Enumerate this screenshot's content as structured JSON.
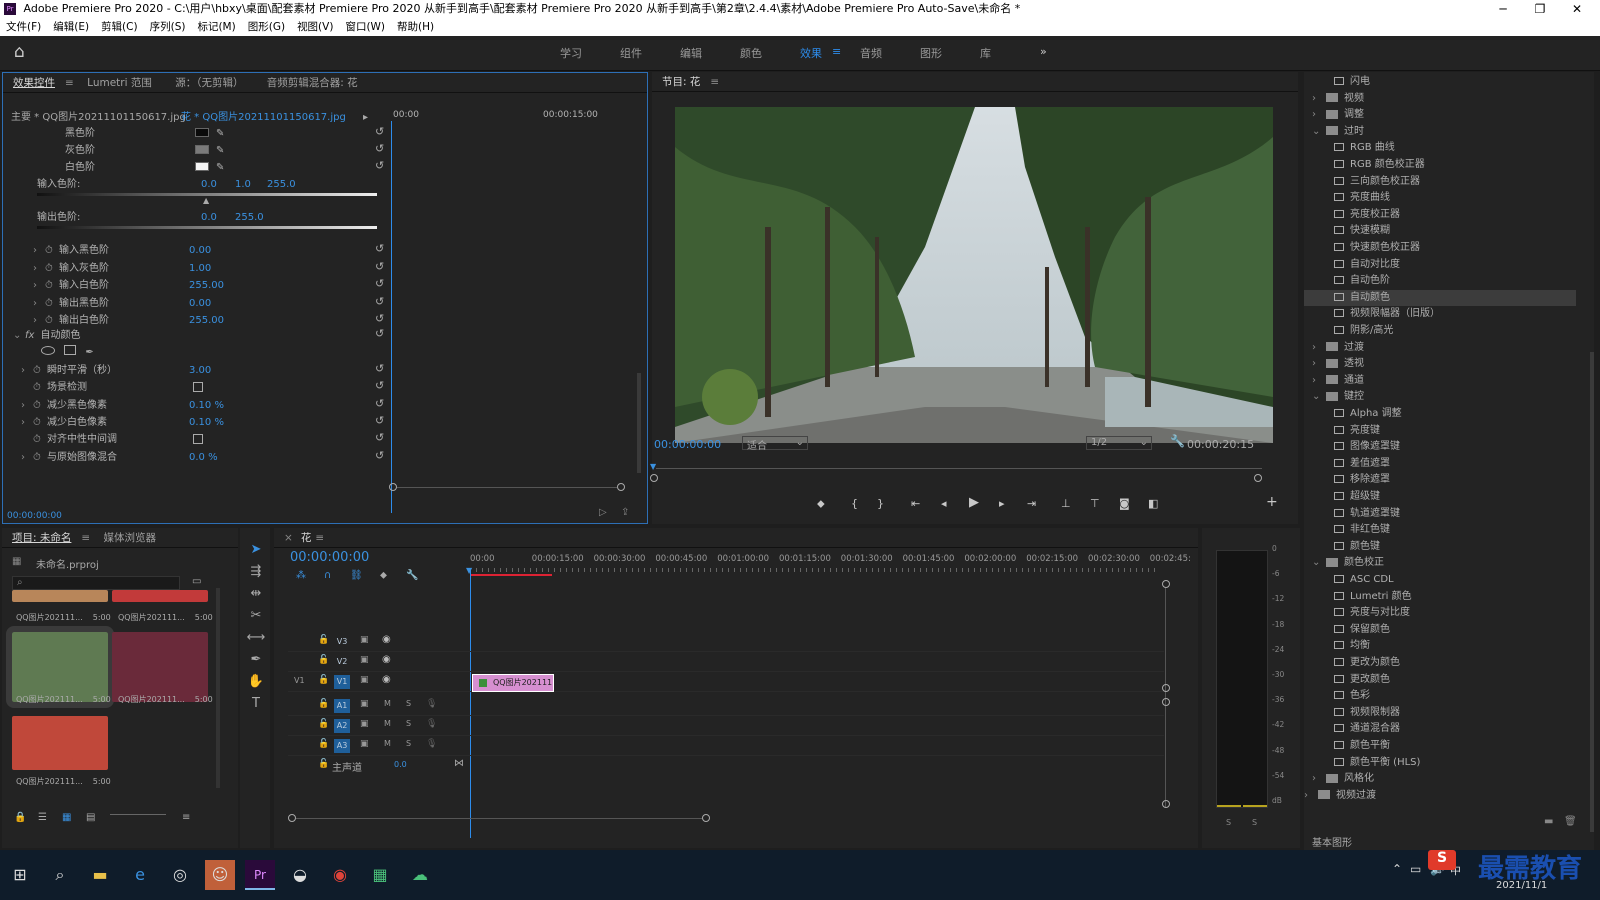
{
  "window": {
    "title": "Adobe Premiere Pro 2020 - C:\\用户\\hbxy\\桌面\\配套素材 Premiere Pro 2020 从新手到高手\\配套素材 Premiere Pro 2020 从新手到高手\\第2章\\2.4.4\\素材\\Adobe Premiere Pro Auto-Save\\未命名 *",
    "icon": "Pr"
  },
  "menu": [
    "文件(F)",
    "编辑(E)",
    "剪辑(C)",
    "序列(S)",
    "标记(M)",
    "图形(G)",
    "视图(V)",
    "窗口(W)",
    "帮助(H)"
  ],
  "workspaces": [
    "学习",
    "组件",
    "编辑",
    "颜色",
    "效果",
    "音频",
    "图形",
    "库"
  ],
  "workspace_active": "效果",
  "effect_controls": {
    "tabs": [
      "效果控件",
      "Lumetri 范围",
      "源：（无剪辑）",
      "音频剪辑混合器: 花"
    ],
    "master": "主要 * QQ图片20211101150617.jpg",
    "clip": "花 * QQ图片20211101150617.jpg",
    "tc_start": "00:00",
    "tc_mid": "00:00:15:00",
    "levels": [
      {
        "label": "黑色阶",
        "swatch": "#0a0a0a"
      },
      {
        "label": "灰色阶",
        "swatch": "#7a7a7a"
      },
      {
        "label": "白色阶",
        "swatch": "#f5f5f5"
      }
    ],
    "input_levels_label": "输入色阶:",
    "input_levels_values": [
      "0.0",
      "1.0",
      "255.0"
    ],
    "output_levels_label": "输出色阶:",
    "output_levels_values": [
      "0.0",
      "255.0"
    ],
    "params": [
      {
        "label": "输入黑色阶",
        "value": "0.00"
      },
      {
        "label": "输入灰色阶",
        "value": "1.00"
      },
      {
        "label": "输入白色阶",
        "value": "255.00"
      },
      {
        "label": "输出黑色阶",
        "value": "0.00"
      },
      {
        "label": "输出白色阶",
        "value": "255.00"
      }
    ],
    "fx_name": "自动颜色",
    "fx_params": [
      {
        "label": "瞬时平滑（秒）",
        "value": "3.00",
        "type": "value"
      },
      {
        "label": "场景检测",
        "value": "",
        "type": "checkbox"
      },
      {
        "label": "减少黑色像素",
        "value": "0.10 %",
        "type": "value"
      },
      {
        "label": "减少白色像素",
        "value": "0.10 %",
        "type": "value"
      },
      {
        "label": "对齐中性中间调",
        "value": "",
        "type": "checkbox"
      },
      {
        "label": "与原始图像混合",
        "value": "0.0 %",
        "type": "value"
      }
    ],
    "timecode": "00:00:00:00"
  },
  "program": {
    "title": "节目: 花",
    "timecode": "00:00:00:00",
    "fit": "适合",
    "resolution": "1/2",
    "duration": "00:00:20:15"
  },
  "effects_tree": [
    {
      "label": "闪电",
      "type": "item",
      "indent": 2
    },
    {
      "label": "视频",
      "type": "folder",
      "indent": 1,
      "open": false
    },
    {
      "label": "调整",
      "type": "folder",
      "indent": 1,
      "open": false
    },
    {
      "label": "过时",
      "type": "folder",
      "indent": 1,
      "open": true
    },
    {
      "label": "RGB 曲线",
      "type": "item",
      "indent": 2
    },
    {
      "label": "RGB 颜色校正器",
      "type": "item",
      "indent": 2
    },
    {
      "label": "三向颜色校正器",
      "type": "item",
      "indent": 2
    },
    {
      "label": "亮度曲线",
      "type": "item",
      "indent": 2
    },
    {
      "label": "亮度校正器",
      "type": "item",
      "indent": 2
    },
    {
      "label": "快速模糊",
      "type": "item",
      "indent": 2
    },
    {
      "label": "快速颜色校正器",
      "type": "item",
      "indent": 2
    },
    {
      "label": "自动对比度",
      "type": "item",
      "indent": 2
    },
    {
      "label": "自动色阶",
      "type": "item",
      "indent": 2
    },
    {
      "label": "自动颜色",
      "type": "item",
      "indent": 2,
      "selected": true
    },
    {
      "label": "视频限幅器（旧版）",
      "type": "item",
      "indent": 2
    },
    {
      "label": "阴影/高光",
      "type": "item",
      "indent": 2
    },
    {
      "label": "过渡",
      "type": "folder",
      "indent": 1,
      "open": false
    },
    {
      "label": "透视",
      "type": "folder",
      "indent": 1,
      "open": false
    },
    {
      "label": "通道",
      "type": "folder",
      "indent": 1,
      "open": false
    },
    {
      "label": "键控",
      "type": "folder",
      "indent": 1,
      "open": true
    },
    {
      "label": "Alpha 调整",
      "type": "item",
      "indent": 2
    },
    {
      "label": "亮度键",
      "type": "item",
      "indent": 2
    },
    {
      "label": "图像遮罩键",
      "type": "item",
      "indent": 2
    },
    {
      "label": "差值遮罩",
      "type": "item",
      "indent": 2
    },
    {
      "label": "移除遮罩",
      "type": "item",
      "indent": 2
    },
    {
      "label": "超级键",
      "type": "item",
      "indent": 2
    },
    {
      "label": "轨道遮罩键",
      "type": "item",
      "indent": 2
    },
    {
      "label": "非红色键",
      "type": "item",
      "indent": 2
    },
    {
      "label": "颜色键",
      "type": "item",
      "indent": 2
    },
    {
      "label": "颜色校正",
      "type": "folder",
      "indent": 1,
      "open": true
    },
    {
      "label": "ASC CDL",
      "type": "item",
      "indent": 2
    },
    {
      "label": "Lumetri 颜色",
      "type": "item",
      "indent": 2
    },
    {
      "label": "亮度与对比度",
      "type": "item",
      "indent": 2
    },
    {
      "label": "保留颜色",
      "type": "item",
      "indent": 2
    },
    {
      "label": "均衡",
      "type": "item",
      "indent": 2
    },
    {
      "label": "更改为颜色",
      "type": "item",
      "indent": 2
    },
    {
      "label": "更改颜色",
      "type": "item",
      "indent": 2
    },
    {
      "label": "色彩",
      "type": "item",
      "indent": 2
    },
    {
      "label": "视频限制器",
      "type": "item",
      "indent": 2
    },
    {
      "label": "通道混合器",
      "type": "item",
      "indent": 2
    },
    {
      "label": "颜色平衡",
      "type": "item",
      "indent": 2
    },
    {
      "label": "颜色平衡 (HLS)",
      "type": "item",
      "indent": 2
    },
    {
      "label": "风格化",
      "type": "folder",
      "indent": 1,
      "open": false
    },
    {
      "label": "视频过渡",
      "type": "folder",
      "indent": 0,
      "open": false
    }
  ],
  "effects_footer": "基本图形",
  "project": {
    "tabs": [
      "项目: 未命名",
      "媒体浏览器"
    ],
    "file": "未命名.prproj",
    "items": [
      {
        "name": "QQ图片202111...",
        "dur": "5:00",
        "color": "#b8865a"
      },
      {
        "name": "QQ图片202111...",
        "dur": "5:00",
        "color": "#c23a3a"
      },
      {
        "name": "QQ图片202111...",
        "dur": "5:00",
        "color": "#5f7a52"
      },
      {
        "name": "QQ图片202111...",
        "dur": "5:00",
        "color": "#6a2a3a"
      },
      {
        "name": "QQ图片202111...",
        "dur": "5:00",
        "color": "#c0483a"
      }
    ]
  },
  "timeline": {
    "tab": "花",
    "timecode": "00:00:00:00",
    "ruler": [
      "00:00",
      "00:00:15:00",
      "00:00:30:00",
      "00:00:45:00",
      "00:01:00:00",
      "00:01:15:00",
      "00:01:30:00",
      "00:01:45:00",
      "00:02:00:00",
      "00:02:15:00",
      "00:02:30:00",
      "00:02:45:"
    ],
    "video_tracks": [
      "V3",
      "V2",
      "V1"
    ],
    "audio_tracks": [
      "A1",
      "A2",
      "A3"
    ],
    "src_v1": "V1",
    "master_label": "主声道",
    "master_value": "0.0",
    "clip_label": "QQ图片202111",
    "mute": "M",
    "solo": "S"
  },
  "meter": {
    "scale": [
      "0",
      "-6",
      "-12",
      "-18",
      "-24",
      "-30",
      "-36",
      "-42",
      "-48",
      "-54",
      "dB"
    ],
    "buttons": [
      "S",
      "S"
    ]
  },
  "taskbar": {
    "date": "2021/11/1",
    "watermark": "最需教育",
    "ime": "中"
  }
}
